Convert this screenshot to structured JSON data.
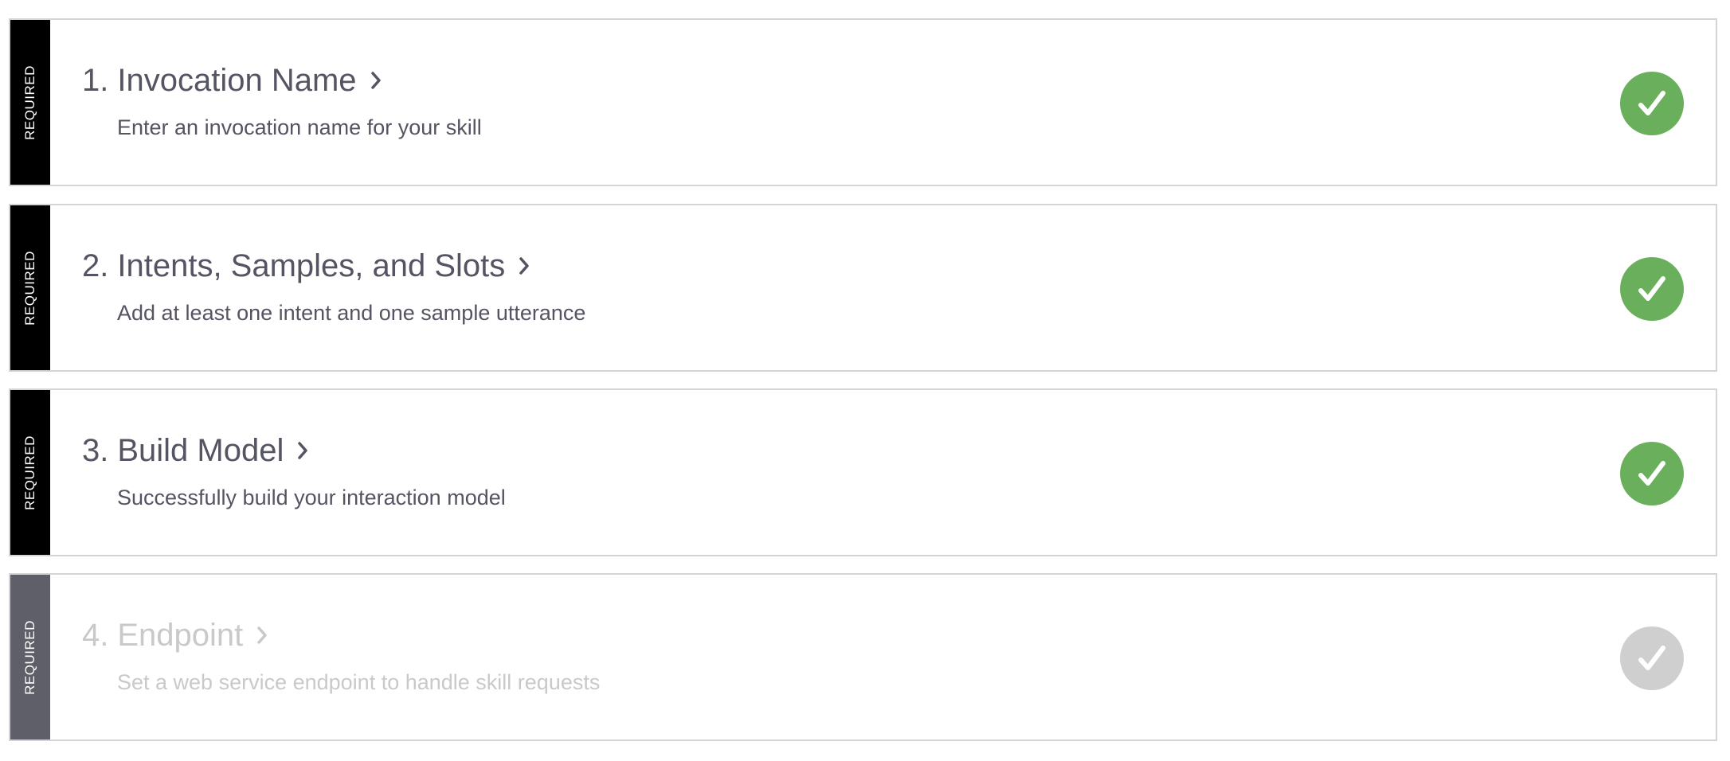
{
  "colors": {
    "required_bar_active": "#000000",
    "required_bar_disabled": "#5f5f69",
    "complete_green": "#6aaf5b",
    "incomplete_gray": "#cfcfcf",
    "text_dark": "#545462",
    "text_disabled": "#c9c9c9"
  },
  "steps": [
    {
      "badge": "REQUIRED",
      "number": "1.",
      "title": "Invocation Name",
      "description": "Enter an invocation name for your skill",
      "status_icon": "check-circle-icon",
      "complete": true
    },
    {
      "badge": "REQUIRED",
      "number": "2.",
      "title": "Intents, Samples, and Slots",
      "description": "Add at least one intent and one sample utterance",
      "status_icon": "check-circle-icon",
      "complete": true
    },
    {
      "badge": "REQUIRED",
      "number": "3.",
      "title": "Build Model",
      "description": "Successfully build your interaction model",
      "status_icon": "check-circle-icon",
      "complete": true
    },
    {
      "badge": "REQUIRED",
      "number": "4.",
      "title": "Endpoint",
      "description": "Set a web service endpoint to handle skill requests",
      "status_icon": "check-circle-icon",
      "complete": false
    }
  ]
}
